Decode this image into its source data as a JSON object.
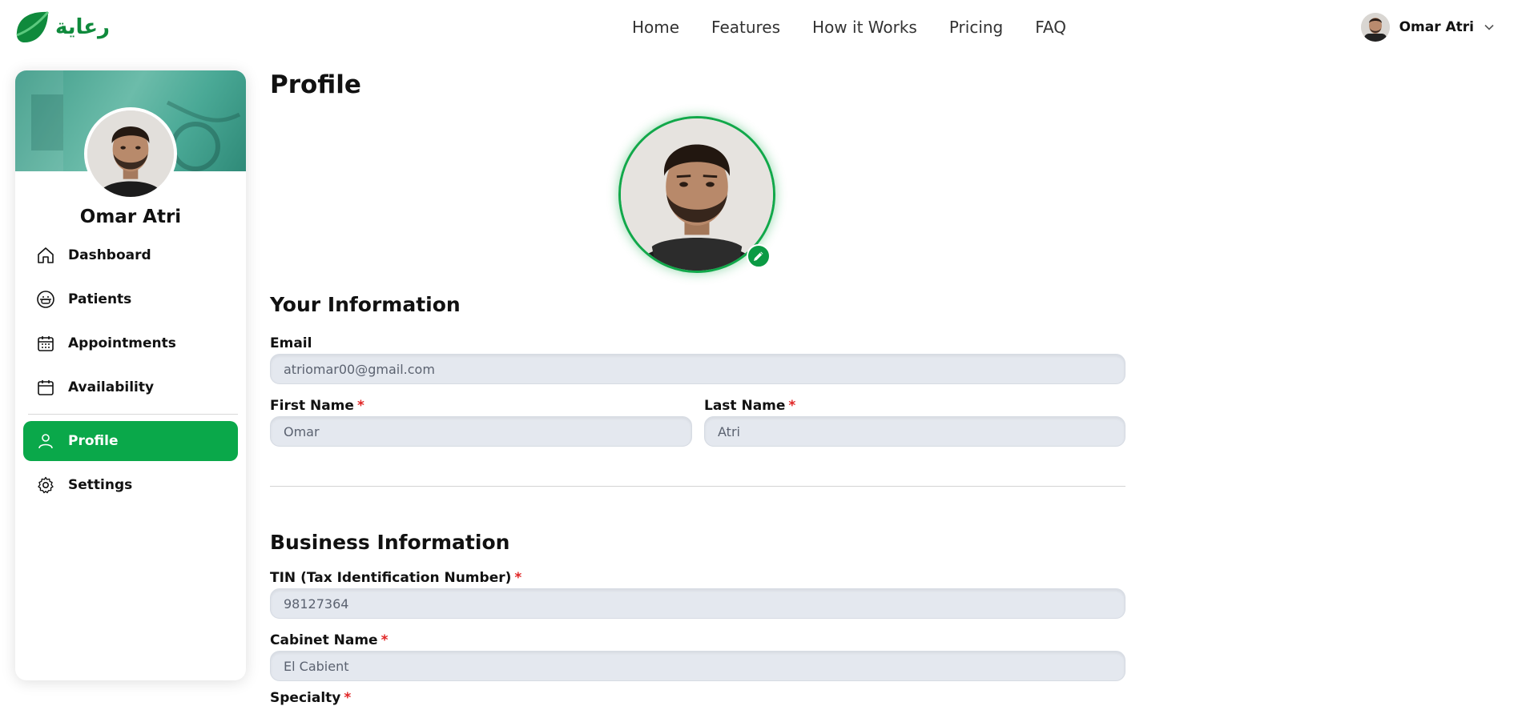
{
  "brand": {
    "name": "رعاية",
    "accent": "#0aa84a"
  },
  "nav": {
    "links": [
      "Home",
      "Features",
      "How it Works",
      "Pricing",
      "FAQ"
    ]
  },
  "user": {
    "name": "Omar Atri"
  },
  "sidebar": {
    "name": "Omar Atri",
    "items": [
      {
        "label": "Dashboard",
        "icon": "home-icon"
      },
      {
        "label": "Patients",
        "icon": "patient-icon"
      },
      {
        "label": "Appointments",
        "icon": "calendar-grid-icon"
      },
      {
        "label": "Availability",
        "icon": "calendar-icon"
      },
      {
        "label": "Profile",
        "icon": "user-icon",
        "active": true
      },
      {
        "label": "Settings",
        "icon": "gear-icon"
      }
    ]
  },
  "page": {
    "title": "Profile"
  },
  "your_info": {
    "title": "Your Information",
    "email_label": "Email",
    "email_value": "atriomar00@gmail.com",
    "first_name_label": "First Name",
    "first_name_value": "Omar",
    "last_name_label": "Last Name",
    "last_name_value": "Atri",
    "required_mark": "*"
  },
  "business_info": {
    "title": "Business Information",
    "tin_label": "TIN (Tax Identification Number)",
    "tin_value": "98127364",
    "cabinet_label": "Cabinet Name",
    "cabinet_value": "El Cabient",
    "specialty_label": "Specialty"
  }
}
